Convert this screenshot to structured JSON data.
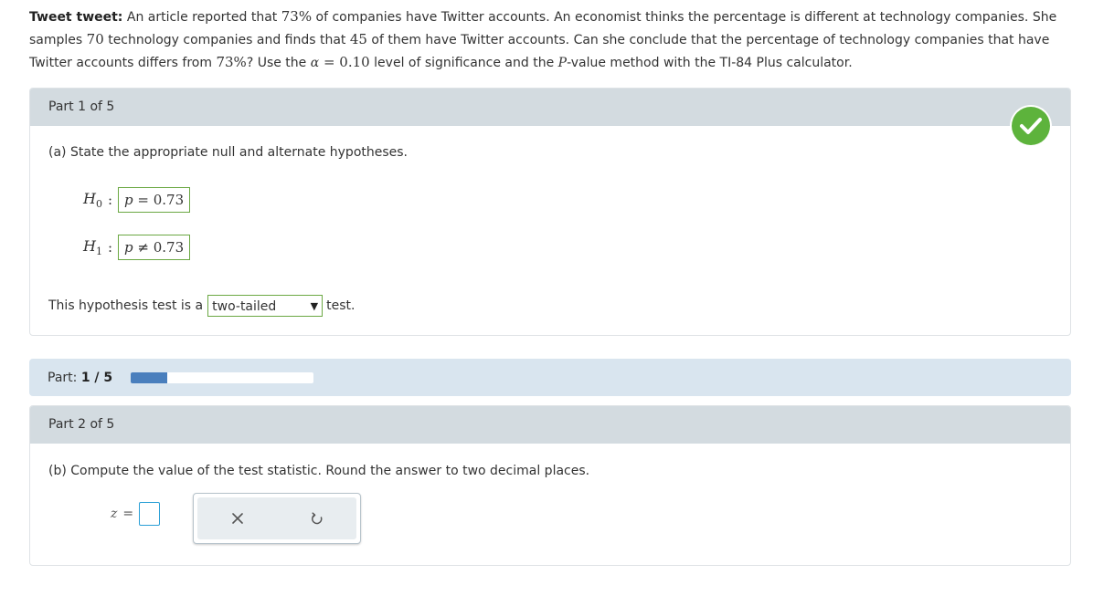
{
  "problem": {
    "title": "Tweet tweet:",
    "seg1": " An article reported that ",
    "m1": "73%",
    "seg2": " of companies have Twitter accounts. An economist thinks the percentage is different at technology companies. She samples ",
    "m2": "70",
    "seg3": " technology companies and finds that ",
    "m3": "45",
    "seg4": " of them have Twitter accounts. Can she conclude that the percentage of technology companies that have Twitter accounts differs from ",
    "m4": "73%",
    "seg5": "? Use the ",
    "alpha": "α",
    "alpha_eq": " = 0.10",
    "seg6": " level of significance and the ",
    "m5": "P",
    "seg7": "-value method with the TI-84 Plus calculator."
  },
  "part1": {
    "header": "Part 1 of 5",
    "question": "(a) State the appropriate null and alternate hypotheses.",
    "h0_label": "H",
    "h0_sub": "0",
    "h0_var": "p",
    "h0_rest": " = 0.73",
    "h1_label": "H",
    "h1_sub": "1",
    "h1_var": "p",
    "h1_rest": " ≠ 0.73",
    "test_prefix": "This hypothesis test is a",
    "test_selected": "two-tailed",
    "test_suffix": "test.",
    "status_icon": "check-icon",
    "status_color": "#5db33c"
  },
  "progress": {
    "label": "Part:",
    "value": "1 / 5",
    "fraction": 0.2,
    "fill_color": "#4a7fbd"
  },
  "part2": {
    "header": "Part 2 of 5",
    "question": "(b) Compute the value of the test statistic. Round the answer to two decimal places.",
    "z_label": "z",
    "z_eq": "=",
    "z_value": "",
    "clear_icon": "x-icon",
    "undo_icon": "undo-icon"
  }
}
